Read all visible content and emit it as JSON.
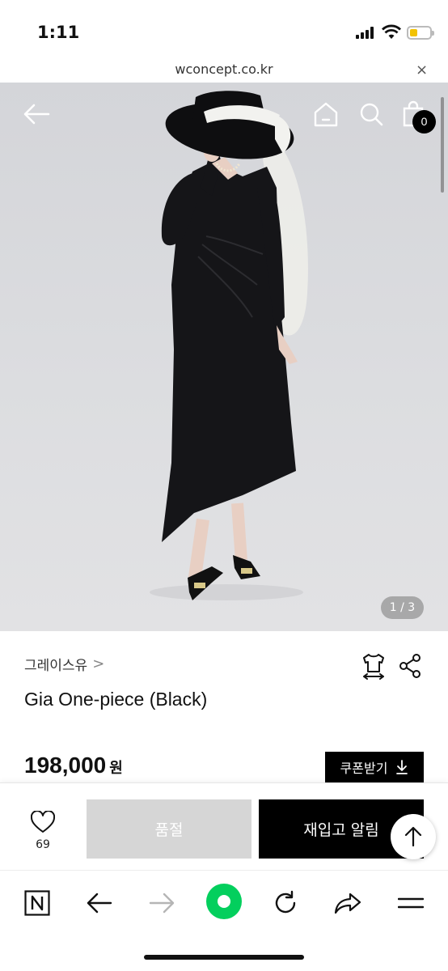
{
  "status_bar": {
    "time": "1:11"
  },
  "browser": {
    "url": "wconcept.co.kr",
    "close_label": "×"
  },
  "hero": {
    "cart_count": "0",
    "page_indicator": "1 / 3"
  },
  "product": {
    "brand": "그레이스유",
    "brand_chevron": ">",
    "name": "Gia One-piece (Black)",
    "price": "198,000",
    "currency": "원",
    "coupon_label": "쿠폰받기"
  },
  "actions": {
    "like_count": "69",
    "soldout_label": "품절",
    "restock_label": "재입고 알림"
  },
  "colors": {
    "accent": "#000000",
    "soldout": "#d6d6d6",
    "naver_green": "#03cf5d",
    "battery": "#f2c200"
  },
  "icons": [
    "back-arrow-icon",
    "home-icon",
    "search-icon",
    "shopping-bag-icon",
    "size-guide-icon",
    "share-icon",
    "heart-icon",
    "download-icon",
    "arrow-up-icon",
    "naver-n-icon",
    "browser-back-icon",
    "browser-forward-icon",
    "naver-green-dot-icon",
    "refresh-icon",
    "browser-share-icon",
    "menu-icon"
  ]
}
